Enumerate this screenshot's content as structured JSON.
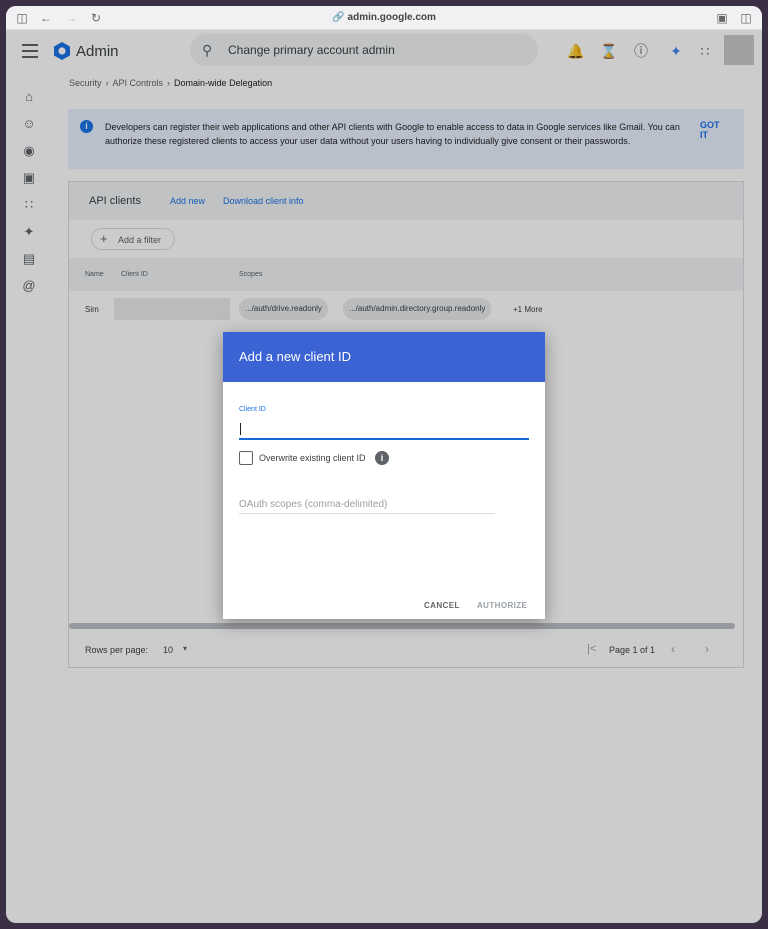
{
  "browser": {
    "url": "admin.google.com"
  },
  "header": {
    "app_name": "Admin",
    "search_text": "Change primary account admin"
  },
  "breadcrumb": [
    "Security",
    "API Controls",
    "Domain-wide Delegation"
  ],
  "banner": {
    "text": "Developers can register their web applications and other API clients with Google to enable access to data in Google services like Gmail. You can authorize these registered clients to access your user data without your users having to individually give consent or their passwords.",
    "action": "GOT IT"
  },
  "clients": {
    "title": "API clients",
    "add_new": "Add new",
    "download": "Download client info",
    "filter": "Add a filter",
    "columns": [
      "Name",
      "Client ID",
      "Scopes"
    ],
    "rows": [
      {
        "name": "Sim",
        "scopes": [
          ".../auth/drive.readonly",
          ".../auth/admin.directory.group.readonly"
        ],
        "more": "+1 More"
      }
    ],
    "pager": {
      "rows_label": "Rows per page:",
      "rows_value": "10",
      "page_text": "Page 1 of 1"
    }
  },
  "dialog": {
    "title": "Add a new client ID",
    "client_id_label": "Client ID",
    "client_id_value": "",
    "overwrite_label": "Overwrite existing client ID",
    "scopes_placeholder": "OAuth scopes (comma-delimited)",
    "cancel": "CANCEL",
    "authorize": "AUTHORIZE"
  },
  "colors": {
    "accent": "#3b63d4",
    "link": "#1a73e8",
    "banner_bg": "#e8f0fe"
  },
  "icons": {
    "browser": [
      "sidebar-icon",
      "back-icon",
      "forward-icon",
      "reload-icon",
      "link-icon",
      "share-icon",
      "split-view-icon"
    ],
    "header": [
      "menu-icon",
      "admin-logo-icon",
      "search-icon",
      "bell-icon",
      "hourglass-icon",
      "help-icon",
      "gemini-icon",
      "apps-grid-icon"
    ],
    "rail": [
      "home-icon",
      "user-icon",
      "chrome-icon",
      "devices-icon",
      "apps-icon",
      "gemini-icon",
      "billing-icon",
      "account-icon"
    ]
  }
}
